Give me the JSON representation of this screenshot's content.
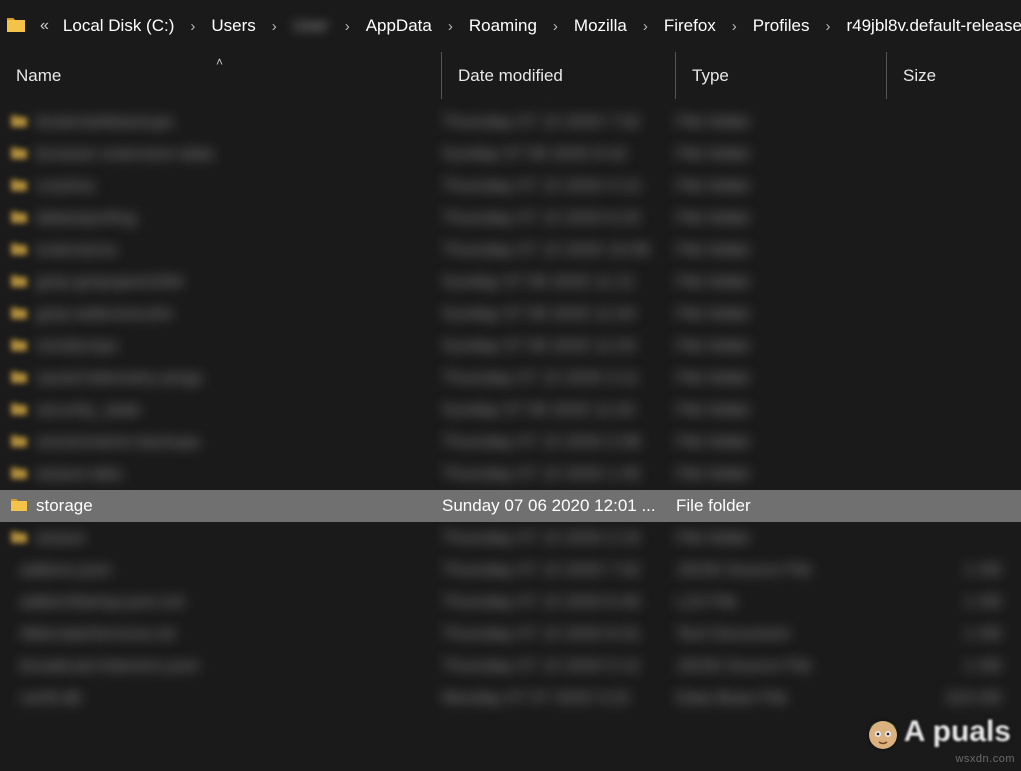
{
  "breadcrumb": {
    "overflow_indicator": "«",
    "items": [
      {
        "label": "Local Disk (C:)",
        "blurred": false
      },
      {
        "label": "Users",
        "blurred": false
      },
      {
        "label": "User",
        "blurred": true
      },
      {
        "label": "AppData",
        "blurred": false
      },
      {
        "label": "Roaming",
        "blurred": false
      },
      {
        "label": "Mozilla",
        "blurred": false
      },
      {
        "label": "Firefox",
        "blurred": false
      },
      {
        "label": "Profiles",
        "blurred": false
      },
      {
        "label": "r49jbl8v.default-release",
        "blurred": false
      }
    ],
    "separator": "›"
  },
  "columns": {
    "name": "Name",
    "date": "Date modified",
    "type": "Type",
    "size": "Size",
    "sort_arrow": "˄"
  },
  "rows": [
    {
      "kind": "folder",
      "name": "bookmarkbackups",
      "date": "Thursday 07 13 2020 7:52",
      "type": "File folder",
      "size": "",
      "blurred": true
    },
    {
      "kind": "folder",
      "name": "browser-extension-data",
      "date": "Sunday 07 06 2020 9:42",
      "type": "File folder",
      "size": "",
      "blurred": true
    },
    {
      "kind": "folder",
      "name": "crashes",
      "date": "Thursday 07 13 2020 4:13",
      "type": "File folder",
      "size": "",
      "blurred": true
    },
    {
      "kind": "folder",
      "name": "datareporting",
      "date": "Thursday 07 13 2020 6:25",
      "type": "File folder",
      "size": "",
      "blurred": true
    },
    {
      "kind": "folder",
      "name": "extensions",
      "date": "Thursday 07 13 2020 10:06",
      "type": "File folder",
      "size": "",
      "blurred": true
    },
    {
      "kind": "folder",
      "name": "gmp-gmpopenh264",
      "date": "Sunday 07 06 2020 11:21",
      "type": "File folder",
      "size": "",
      "blurred": true
    },
    {
      "kind": "folder",
      "name": "gmp-widevinecdm",
      "date": "Sunday 07 06 2020 11:04",
      "type": "File folder",
      "size": "",
      "blurred": true
    },
    {
      "kind": "folder",
      "name": "minidumps",
      "date": "Sunday 07 06 2020 11:03",
      "type": "File folder",
      "size": "",
      "blurred": true
    },
    {
      "kind": "folder",
      "name": "saved-telemetry-pings",
      "date": "Thursday 07 13 2020 3:11",
      "type": "File folder",
      "size": "",
      "blurred": true
    },
    {
      "kind": "folder",
      "name": "security_state",
      "date": "Sunday 07 06 2020 11:02",
      "type": "File folder",
      "size": "",
      "blurred": true
    },
    {
      "kind": "folder",
      "name": "sessionstore-backups",
      "date": "Thursday 07 13 2020 2:08",
      "type": "File folder",
      "size": "",
      "blurred": true
    },
    {
      "kind": "folder",
      "name": "weave-tabs",
      "date": "Thursday 07 13 2020 1:45",
      "type": "File folder",
      "size": "",
      "blurred": true
    },
    {
      "kind": "folder",
      "name": "storage",
      "date": "Sunday 07 06 2020 12:01 ...",
      "type": "File folder",
      "size": "",
      "blurred": false,
      "selected": true
    },
    {
      "kind": "folder",
      "name": "weave",
      "date": "Thursday 07 13 2020 2:15",
      "type": "File folder",
      "size": "",
      "blurred": true
    },
    {
      "kind": "file",
      "name": "addons.json",
      "date": "Thursday 07 13 2020 7:52",
      "type": "JSON Source File",
      "size": "1 KB",
      "blurred": true
    },
    {
      "kind": "file",
      "name": "addonStartup.json.lz4",
      "date": "Thursday 07 13 2020 6:40",
      "type": "LZ4 File",
      "size": "1 KB",
      "blurred": true
    },
    {
      "kind": "file",
      "name": "AlternateServices.txt",
      "date": "Thursday 07 13 2020 8:31",
      "type": "Text Document",
      "size": "1 KB",
      "blurred": true
    },
    {
      "kind": "file",
      "name": "broadcast-listeners.json",
      "date": "Thursday 07 13 2020 5:12",
      "type": "JSON Source File",
      "size": "1 KB",
      "blurred": true
    },
    {
      "kind": "file",
      "name": "cert9.db",
      "date": "Monday 07 07 2020 3:22",
      "type": "Data Base File",
      "size": "224 KB",
      "blurred": true
    }
  ],
  "watermark": {
    "site": "wsxdn.com",
    "logo_text": "A  puals"
  },
  "colors": {
    "bg": "#1a1a1a",
    "text": "#e8e8e8",
    "selected_bg": "#707070",
    "folder_yellow": "#f5c24a",
    "folder_shade": "#d89b1f",
    "logo_green": "#4a8b2b"
  }
}
